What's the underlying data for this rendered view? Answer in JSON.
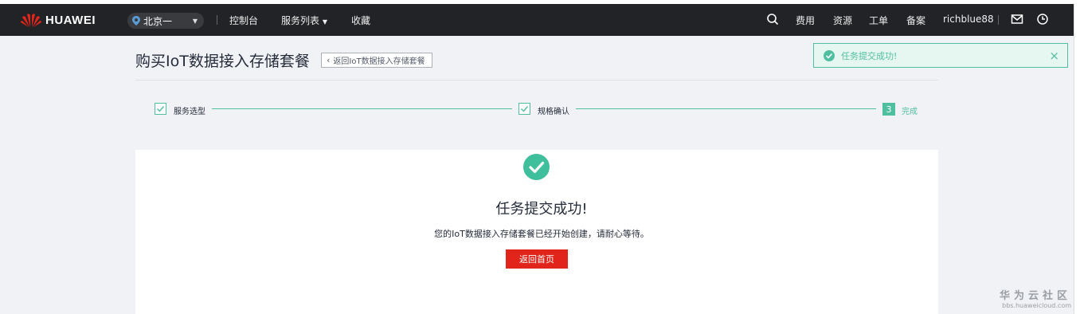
{
  "header": {
    "brand": "HUAWEI",
    "region": "北京一",
    "nav": [
      "控制台",
      "服务列表",
      "收藏"
    ],
    "right_links": [
      "费用",
      "资源",
      "工单",
      "备案"
    ],
    "username": "richblue88"
  },
  "page": {
    "title": "购买IoT数据接入存储套餐",
    "back_label": "返回IoT数据接入存储套餐"
  },
  "toast": {
    "message": "任务提交成功!",
    "close": "×"
  },
  "steps": [
    {
      "label": "服务选型",
      "state": "done"
    },
    {
      "label": "规格确认",
      "state": "done"
    },
    {
      "number": "3",
      "label": "完成",
      "state": "active"
    }
  ],
  "result": {
    "title": "任务提交成功!",
    "description": "您的IoT数据接入存储套餐已经开始创建，请耐心等待。",
    "home_button": "返回首页"
  },
  "watermark": {
    "cn": "华为云社区",
    "url": "bbs.huaweicloud.com"
  },
  "colors": {
    "accent": "#50bfa0",
    "brand_red": "#e1251b",
    "topbar": "#222326"
  }
}
